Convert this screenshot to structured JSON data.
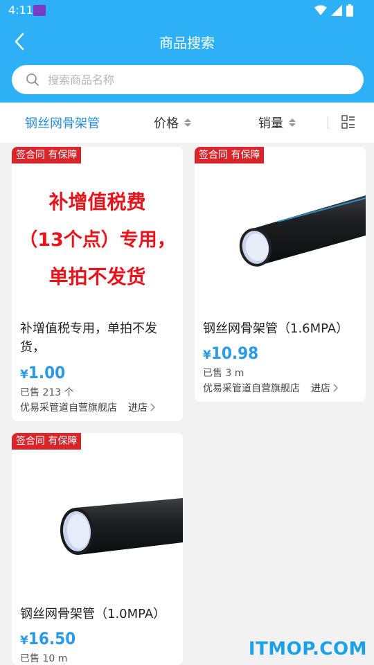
{
  "status": {
    "time": "4:11"
  },
  "header": {
    "title": "商品搜索"
  },
  "search": {
    "placeholder": "搜索商品名称",
    "value": ""
  },
  "filters": {
    "keyword": "钢丝网骨架管",
    "price": "价格",
    "sales": "销量"
  },
  "products": [
    {
      "badge": "签合同 有保障",
      "promo_lines": [
        "补增值税费",
        "（13个点）专用，",
        "单拍不发货"
      ],
      "title": "补增值税专用，单拍不发货，",
      "currency": "¥",
      "price": "1.00",
      "sold": "已售 213 个",
      "shop": "优易采管道自营旗舰店",
      "shop_link": "进店"
    },
    {
      "badge": "签合同 有保障",
      "title": "钢丝网骨架管（1.6MPA）",
      "currency": "¥",
      "price": "10.98",
      "sold": "已售 3 m",
      "shop": "优易采管道自营旗舰店",
      "shop_link": "进店"
    },
    {
      "badge": "签合同 有保障",
      "title": "钢丝网骨架管（1.0MPA）",
      "currency": "¥",
      "price": "16.50",
      "sold": "已售 10 m"
    }
  ],
  "watermark": "ITMOP.COM",
  "colors": {
    "accent": "#2db0f5",
    "price": "#2a9ae8",
    "badge": "#d9242a",
    "promo": "#e8141b"
  }
}
